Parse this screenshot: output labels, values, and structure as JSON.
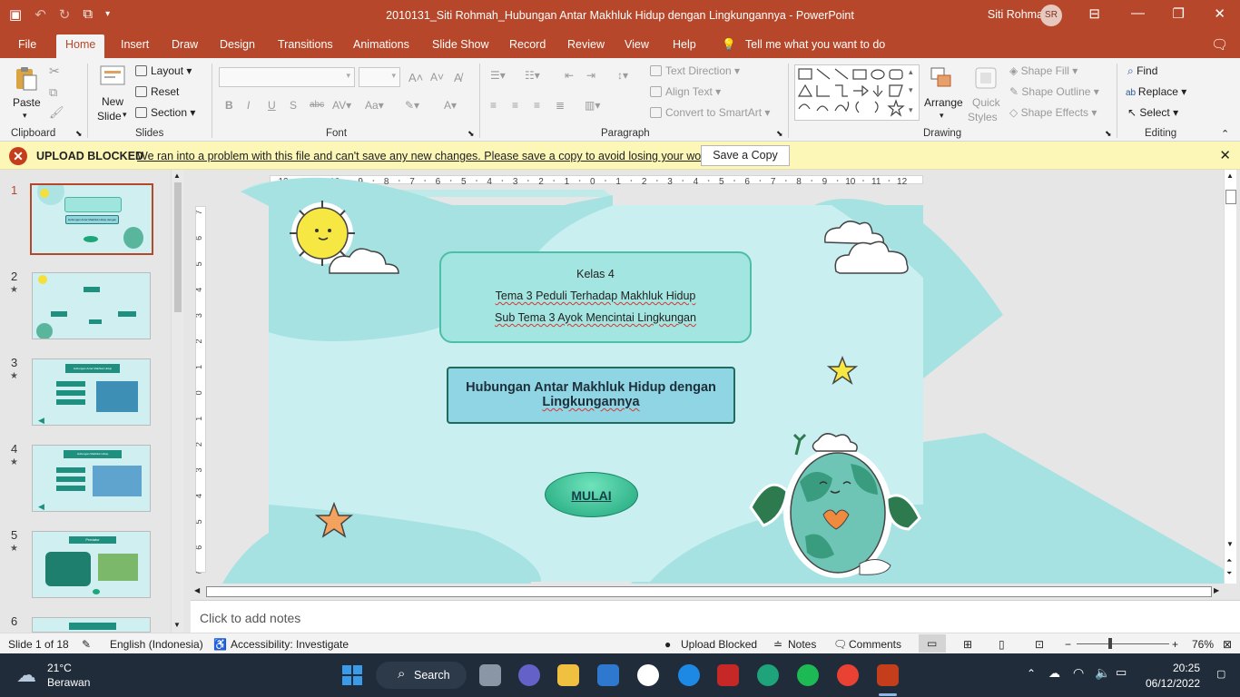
{
  "window": {
    "title": "2010131_Siti Rohmah_Hubungan Antar Makhluk Hidup dengan Lingkungannya  -  PowerPoint",
    "user": "Siti Rohmah",
    "user_initials": "SR"
  },
  "tabs": [
    "File",
    "Home",
    "Insert",
    "Draw",
    "Design",
    "Transitions",
    "Animations",
    "Slide Show",
    "Record",
    "Review",
    "View",
    "Help"
  ],
  "tell_me": "Tell me what you want to do",
  "ribbon": {
    "clipboard": {
      "paste": "Paste",
      "label": "Clipboard"
    },
    "slides": {
      "new_slide_1": "New",
      "new_slide_2": "Slide",
      "layout": "Layout",
      "reset": "Reset",
      "section": "Section",
      "label": "Slides"
    },
    "font": {
      "label": "Font",
      "bold": "B",
      "italic": "I",
      "underline": "U",
      "strike": "S",
      "case": "Aa"
    },
    "paragraph": {
      "label": "Paragraph",
      "text_direction": "Text Direction",
      "align_text": "Align Text",
      "convert": "Convert to SmartArt"
    },
    "drawing": {
      "label": "Drawing",
      "arrange": "Arrange",
      "quick_styles_1": "Quick",
      "quick_styles_2": "Styles",
      "shape_fill": "Shape Fill",
      "shape_outline": "Shape Outline",
      "shape_effects": "Shape Effects"
    },
    "editing": {
      "label": "Editing",
      "find": "Find",
      "replace": "Replace",
      "select": "Select"
    }
  },
  "message_bar": {
    "heading": "UPLOAD BLOCKED",
    "message": "We ran into a problem with this file and can't save any new changes. Please save a copy to avoid losing your work.",
    "button": "Save a Copy"
  },
  "thumbnails": [
    {
      "num": "1",
      "title": "Hubungan Antar Makhluk Hidup dengan Lingkungannya"
    },
    {
      "num": "2"
    },
    {
      "num": "3",
      "title": "Hubungan Antar Makhluk Hidup"
    },
    {
      "num": "4",
      "title": "Hubungan Makhluk Hidup"
    },
    {
      "num": "5",
      "title": "Predator"
    },
    {
      "num": "6"
    }
  ],
  "ruler": {
    "h_labels": [
      "12",
      "11",
      "10",
      "9",
      "8",
      "7",
      "6",
      "5",
      "4",
      "3",
      "2",
      "1",
      "0",
      "1",
      "2",
      "3",
      "4",
      "5",
      "6",
      "7",
      "8",
      "9",
      "10",
      "11",
      "12"
    ],
    "v_labels": [
      "7",
      "6",
      "5",
      "4",
      "3",
      "2",
      "1",
      "0",
      "1",
      "2",
      "3",
      "4",
      "5",
      "6",
      "7"
    ]
  },
  "slide": {
    "line1": "Kelas 4",
    "line2": "Tema 3 Peduli Terhadap Makhluk Hidup",
    "line3": "Sub Tema 3 Ayok Mencintai Lingkungan",
    "title_line1": "Hubungan Antar Makhluk Hidup dengan",
    "title_line2": "Lingkungannya",
    "button": "MULAI"
  },
  "notes_placeholder": "Click to add notes",
  "status": {
    "slide_of": "Slide 1 of 18",
    "language": "English (Indonesia)",
    "accessibility": "Accessibility: Investigate",
    "upload": "Upload Blocked",
    "notes": "Notes",
    "comments": "Comments",
    "zoom": "76%"
  },
  "taskbar": {
    "temp": "21°C",
    "weather": "Berawan",
    "search": "Search",
    "time": "20:25",
    "date": "06/12/2022"
  },
  "colors": {
    "accent": "#b7472a",
    "slide_bg": "#c9eff0",
    "teal": "#1f7f6e"
  }
}
